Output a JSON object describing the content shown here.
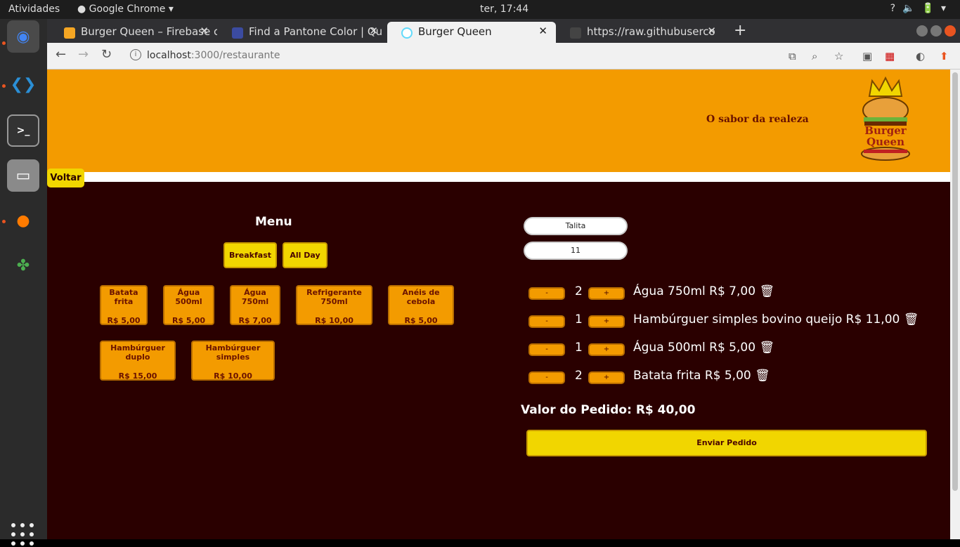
{
  "system": {
    "activities": "Atividades",
    "app_name": "Google Chrome",
    "clock": "ter, 17:44"
  },
  "browser": {
    "tabs": [
      {
        "title": "Burger Queen – Firebase c",
        "favicon_color": "#f5a623"
      },
      {
        "title": "Find a Pantone Color | Qu",
        "favicon_color": "#3b4ba0"
      },
      {
        "title": "Burger Queen",
        "favicon_color": "#61dafb"
      },
      {
        "title": "https://raw.githubuserco",
        "favicon_color": "#444"
      }
    ],
    "url_host": "localhost",
    "url_path": ":3000/restaurante"
  },
  "header": {
    "slogan": "O sabor da realeza",
    "logo_text": [
      "Burger",
      "Queen"
    ]
  },
  "voltar_label": "Voltar",
  "menu": {
    "title": "Menu",
    "categories": [
      "Breakfast",
      "All Day"
    ],
    "items": [
      {
        "name": "Batata frita",
        "price": "R$ 5,00"
      },
      {
        "name": "Água 500ml",
        "price": "R$ 5,00"
      },
      {
        "name": "Água 750ml",
        "price": "R$ 7,00"
      },
      {
        "name": "Refrigerante 750ml",
        "price": "R$ 10,00"
      },
      {
        "name": "Anéis de cebola",
        "price": "R$ 5,00"
      },
      {
        "name": "Hambúrguer duplo",
        "price": "R$ 15,00"
      },
      {
        "name": "Hambúrguer simples",
        "price": "R$ 10,00"
      }
    ]
  },
  "order": {
    "client_name": "Talita",
    "table": "11",
    "minus": "-",
    "plus": "+",
    "items": [
      {
        "qty": "2",
        "label": "Água 750ml R$ 7,00 🗑"
      },
      {
        "qty": "1",
        "label": " Hambúrguer simples bovino queijo R$ 11,00 🗑"
      },
      {
        "qty": "1",
        "label": "Água 500ml R$ 5,00 🗑"
      },
      {
        "qty": "2",
        "label": "Batata frita R$ 5,00 🗑"
      }
    ],
    "total": "Valor do Pedido: R$ 40,00",
    "send_label": "Enviar Pedido"
  },
  "colors": {
    "header": "#f39b00",
    "page_bg": "#2a0000",
    "accent_yellow": "#f1d600"
  }
}
